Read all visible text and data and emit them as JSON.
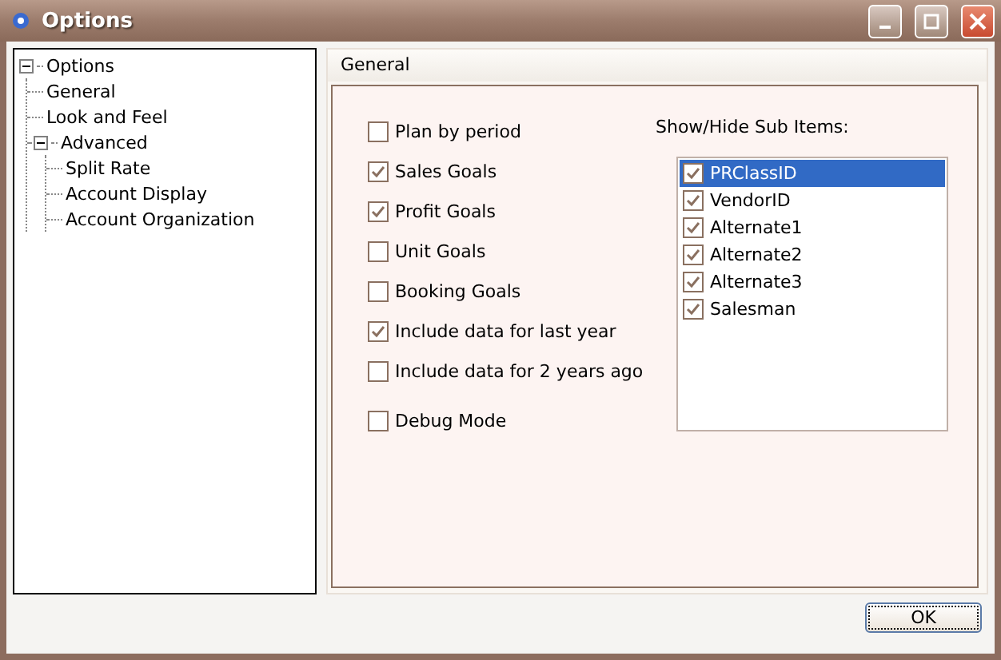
{
  "window": {
    "title": "Options"
  },
  "tree": [
    {
      "label": "Options",
      "expanded": true,
      "children": [
        {
          "label": "General"
        },
        {
          "label": "Look and Feel"
        },
        {
          "label": "Advanced",
          "expanded": true,
          "children": [
            {
              "label": "Split Rate"
            },
            {
              "label": "Account Display"
            },
            {
              "label": "Account Organization"
            }
          ]
        }
      ]
    }
  ],
  "panel": {
    "title": "General"
  },
  "options": [
    {
      "label": "Plan by period",
      "checked": false
    },
    {
      "label": "Sales Goals",
      "checked": true
    },
    {
      "label": "Profit Goals",
      "checked": true
    },
    {
      "label": "Unit Goals",
      "checked": false
    },
    {
      "label": "Booking Goals",
      "checked": false
    },
    {
      "label": "Include data for last year",
      "checked": true
    },
    {
      "label": "Include data for 2 years ago",
      "checked": false
    },
    {
      "label": "Debug Mode",
      "checked": false
    }
  ],
  "sub_items": {
    "label": "Show/Hide Sub Items:",
    "items": [
      {
        "label": "PRClassID",
        "checked": true,
        "selected": true
      },
      {
        "label": "VendorID",
        "checked": true,
        "selected": false
      },
      {
        "label": "Alternate1",
        "checked": true,
        "selected": false
      },
      {
        "label": "Alternate2",
        "checked": true,
        "selected": false
      },
      {
        "label": "Alternate3",
        "checked": true,
        "selected": false
      },
      {
        "label": "Salesman",
        "checked": true,
        "selected": false
      }
    ]
  },
  "buttons": [
    {
      "label": "OK"
    }
  ]
}
